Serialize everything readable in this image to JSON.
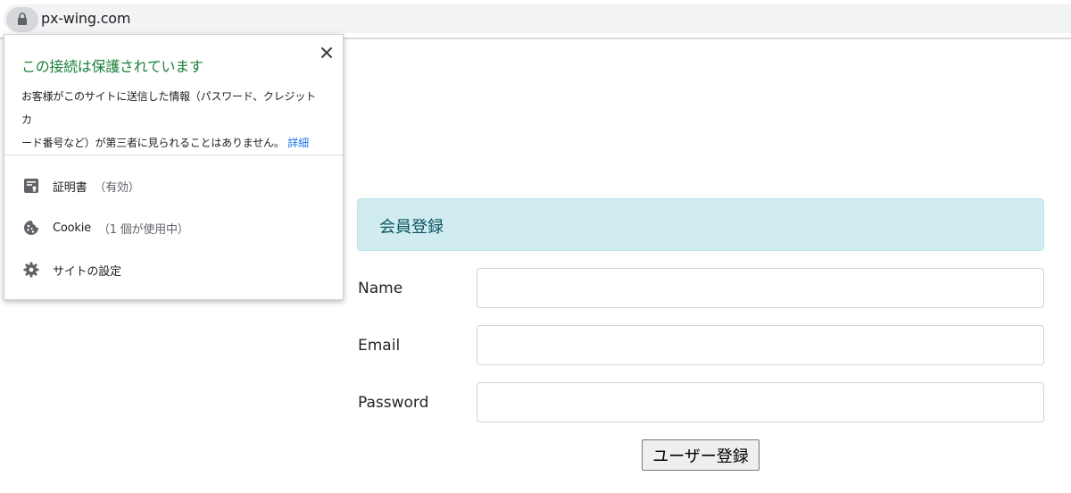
{
  "address_bar": {
    "url": "px-wing.com",
    "lock_icon": "lock-icon"
  },
  "security_popup": {
    "title": "この接続は保護されています",
    "description_line1": "お客様がこのサイトに送信した情報（パスワード、クレジット カ",
    "description_line2": "ード番号など）が第三者に見られることはありません。",
    "details_link": "詳細",
    "close_icon": "close-icon",
    "items": [
      {
        "icon": "certificate-icon",
        "label": "証明書",
        "sub": "（有効）"
      },
      {
        "icon": "cookie-icon",
        "label": "Cookie",
        "sub": "（1 個が使用中）"
      },
      {
        "icon": "gear-icon",
        "label": "サイトの設定",
        "sub": ""
      }
    ]
  },
  "form": {
    "header": "会員登録",
    "fields": [
      {
        "label": "Name",
        "value": ""
      },
      {
        "label": "Email",
        "value": ""
      },
      {
        "label": "Password",
        "value": ""
      }
    ],
    "submit_label": "ユーザー登録"
  },
  "colors": {
    "secure_green": "#188038",
    "link_blue": "#1a73e8",
    "header_bg": "#d1ecf1",
    "header_text": "#0c5460"
  }
}
